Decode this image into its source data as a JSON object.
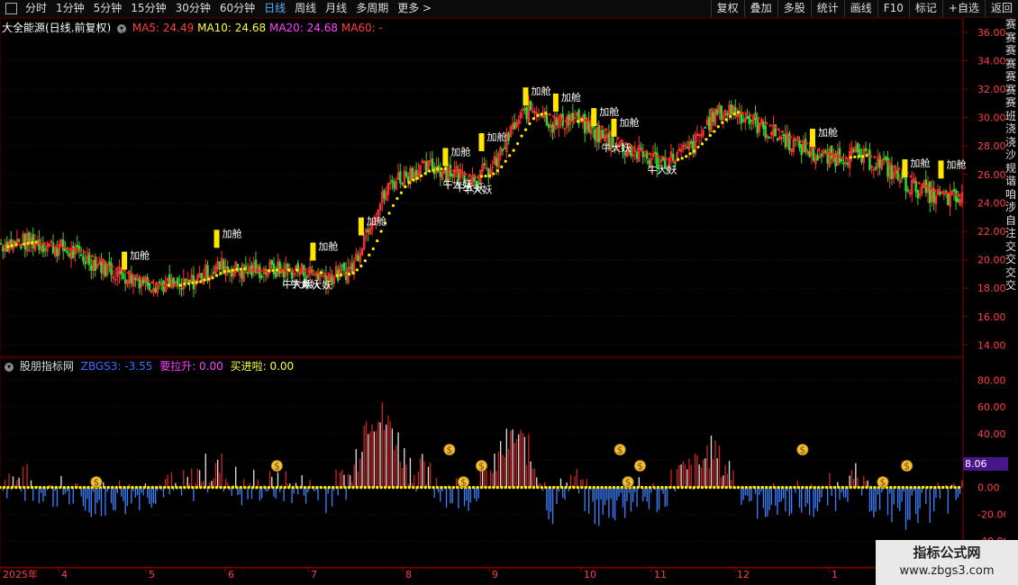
{
  "toolbar": {
    "tabs": [
      "分时",
      "1分钟",
      "5分钟",
      "15分钟",
      "30分钟",
      "60分钟",
      "日线",
      "周线",
      "月线",
      "多周期",
      "更多 >"
    ],
    "active_tab": 6,
    "right_buttons": [
      "复权",
      "叠加",
      "多股",
      "统计",
      "画线",
      "F10",
      "标记",
      "+自选",
      "返回"
    ]
  },
  "main_info": {
    "stock": "大全能源(日线,前复权)",
    "ma5": "MA5: 24.49",
    "ma10": "MA10: 24.68",
    "ma20": "MA20: 24.68",
    "ma60": "MA60: -"
  },
  "sub_info": {
    "name": "股朋指标网",
    "zbgs3": "ZBGS3: -3.55",
    "yaolasheng": "要拉升: 0.00",
    "maijinla": "买进啦: 0.00"
  },
  "price_axis": [
    "36.00",
    "34.00",
    "32.00",
    "30.00",
    "28.00",
    "26.00",
    "24.00",
    "22.00",
    "20.00",
    "18.00",
    "16.00",
    "14.00"
  ],
  "ind_axis": [
    "80.00",
    "60.00",
    "40.00",
    "20.00",
    "0.00",
    "-20.00",
    "-40.00"
  ],
  "ind_value_box": "8.06",
  "date_axis": [
    "2025年",
    "4",
    "5",
    "6",
    "7",
    "8",
    "9",
    "10",
    "11",
    "12",
    "1"
  ],
  "markers": {
    "add": "加舱",
    "bull": "牛大妖"
  },
  "side_strip": "赛赛赛赛赛赛赛班浇浇沙规谐咱涉自注交交交交",
  "watermark": {
    "line1": "指标公式网",
    "line2": "www.zbgs3.com"
  },
  "chart_data": {
    "type": "candlestick",
    "title": "大全能源(日线,前复权)",
    "ylim": [
      13.2,
      37
    ],
    "ind_ylim": [
      -58,
      95
    ],
    "control_points": [
      [
        0,
        21.1
      ],
      [
        15,
        21.3
      ],
      [
        30,
        20.8
      ],
      [
        45,
        19.9
      ],
      [
        60,
        19.0
      ],
      [
        75,
        18.4
      ],
      [
        90,
        18.0
      ],
      [
        100,
        18.9
      ],
      [
        110,
        19.6
      ],
      [
        120,
        19.2
      ],
      [
        135,
        19.3
      ],
      [
        150,
        19.2
      ],
      [
        165,
        18.8
      ],
      [
        175,
        19.4
      ],
      [
        183,
        22.5
      ],
      [
        195,
        25.5
      ],
      [
        205,
        26.2
      ],
      [
        215,
        26.5
      ],
      [
        225,
        26.2
      ],
      [
        235,
        25.8
      ],
      [
        245,
        26.4
      ],
      [
        255,
        29.2
      ],
      [
        262,
        30.5
      ],
      [
        268,
        30.7
      ],
      [
        275,
        29.5
      ],
      [
        285,
        30.0
      ],
      [
        300,
        28.6
      ],
      [
        315,
        27.6
      ],
      [
        330,
        26.8
      ],
      [
        345,
        28.0
      ],
      [
        355,
        30.2
      ],
      [
        365,
        30.6
      ],
      [
        380,
        29.2
      ],
      [
        395,
        28.2
      ],
      [
        410,
        27.1
      ],
      [
        425,
        27.4
      ],
      [
        440,
        26.6
      ],
      [
        452,
        25.3
      ],
      [
        465,
        24.5
      ],
      [
        478,
        24.2
      ]
    ],
    "markers_add_bars": [
      62,
      108,
      156,
      180,
      222,
      240,
      262,
      277,
      296,
      306,
      405,
      451,
      469
    ],
    "markers_bull_bars": [
      146,
      150,
      156,
      226,
      232,
      236,
      305,
      328
    ],
    "signal_bars": [
      48,
      138,
      224,
      231,
      240,
      309,
      313,
      319,
      400,
      440,
      452
    ]
  }
}
